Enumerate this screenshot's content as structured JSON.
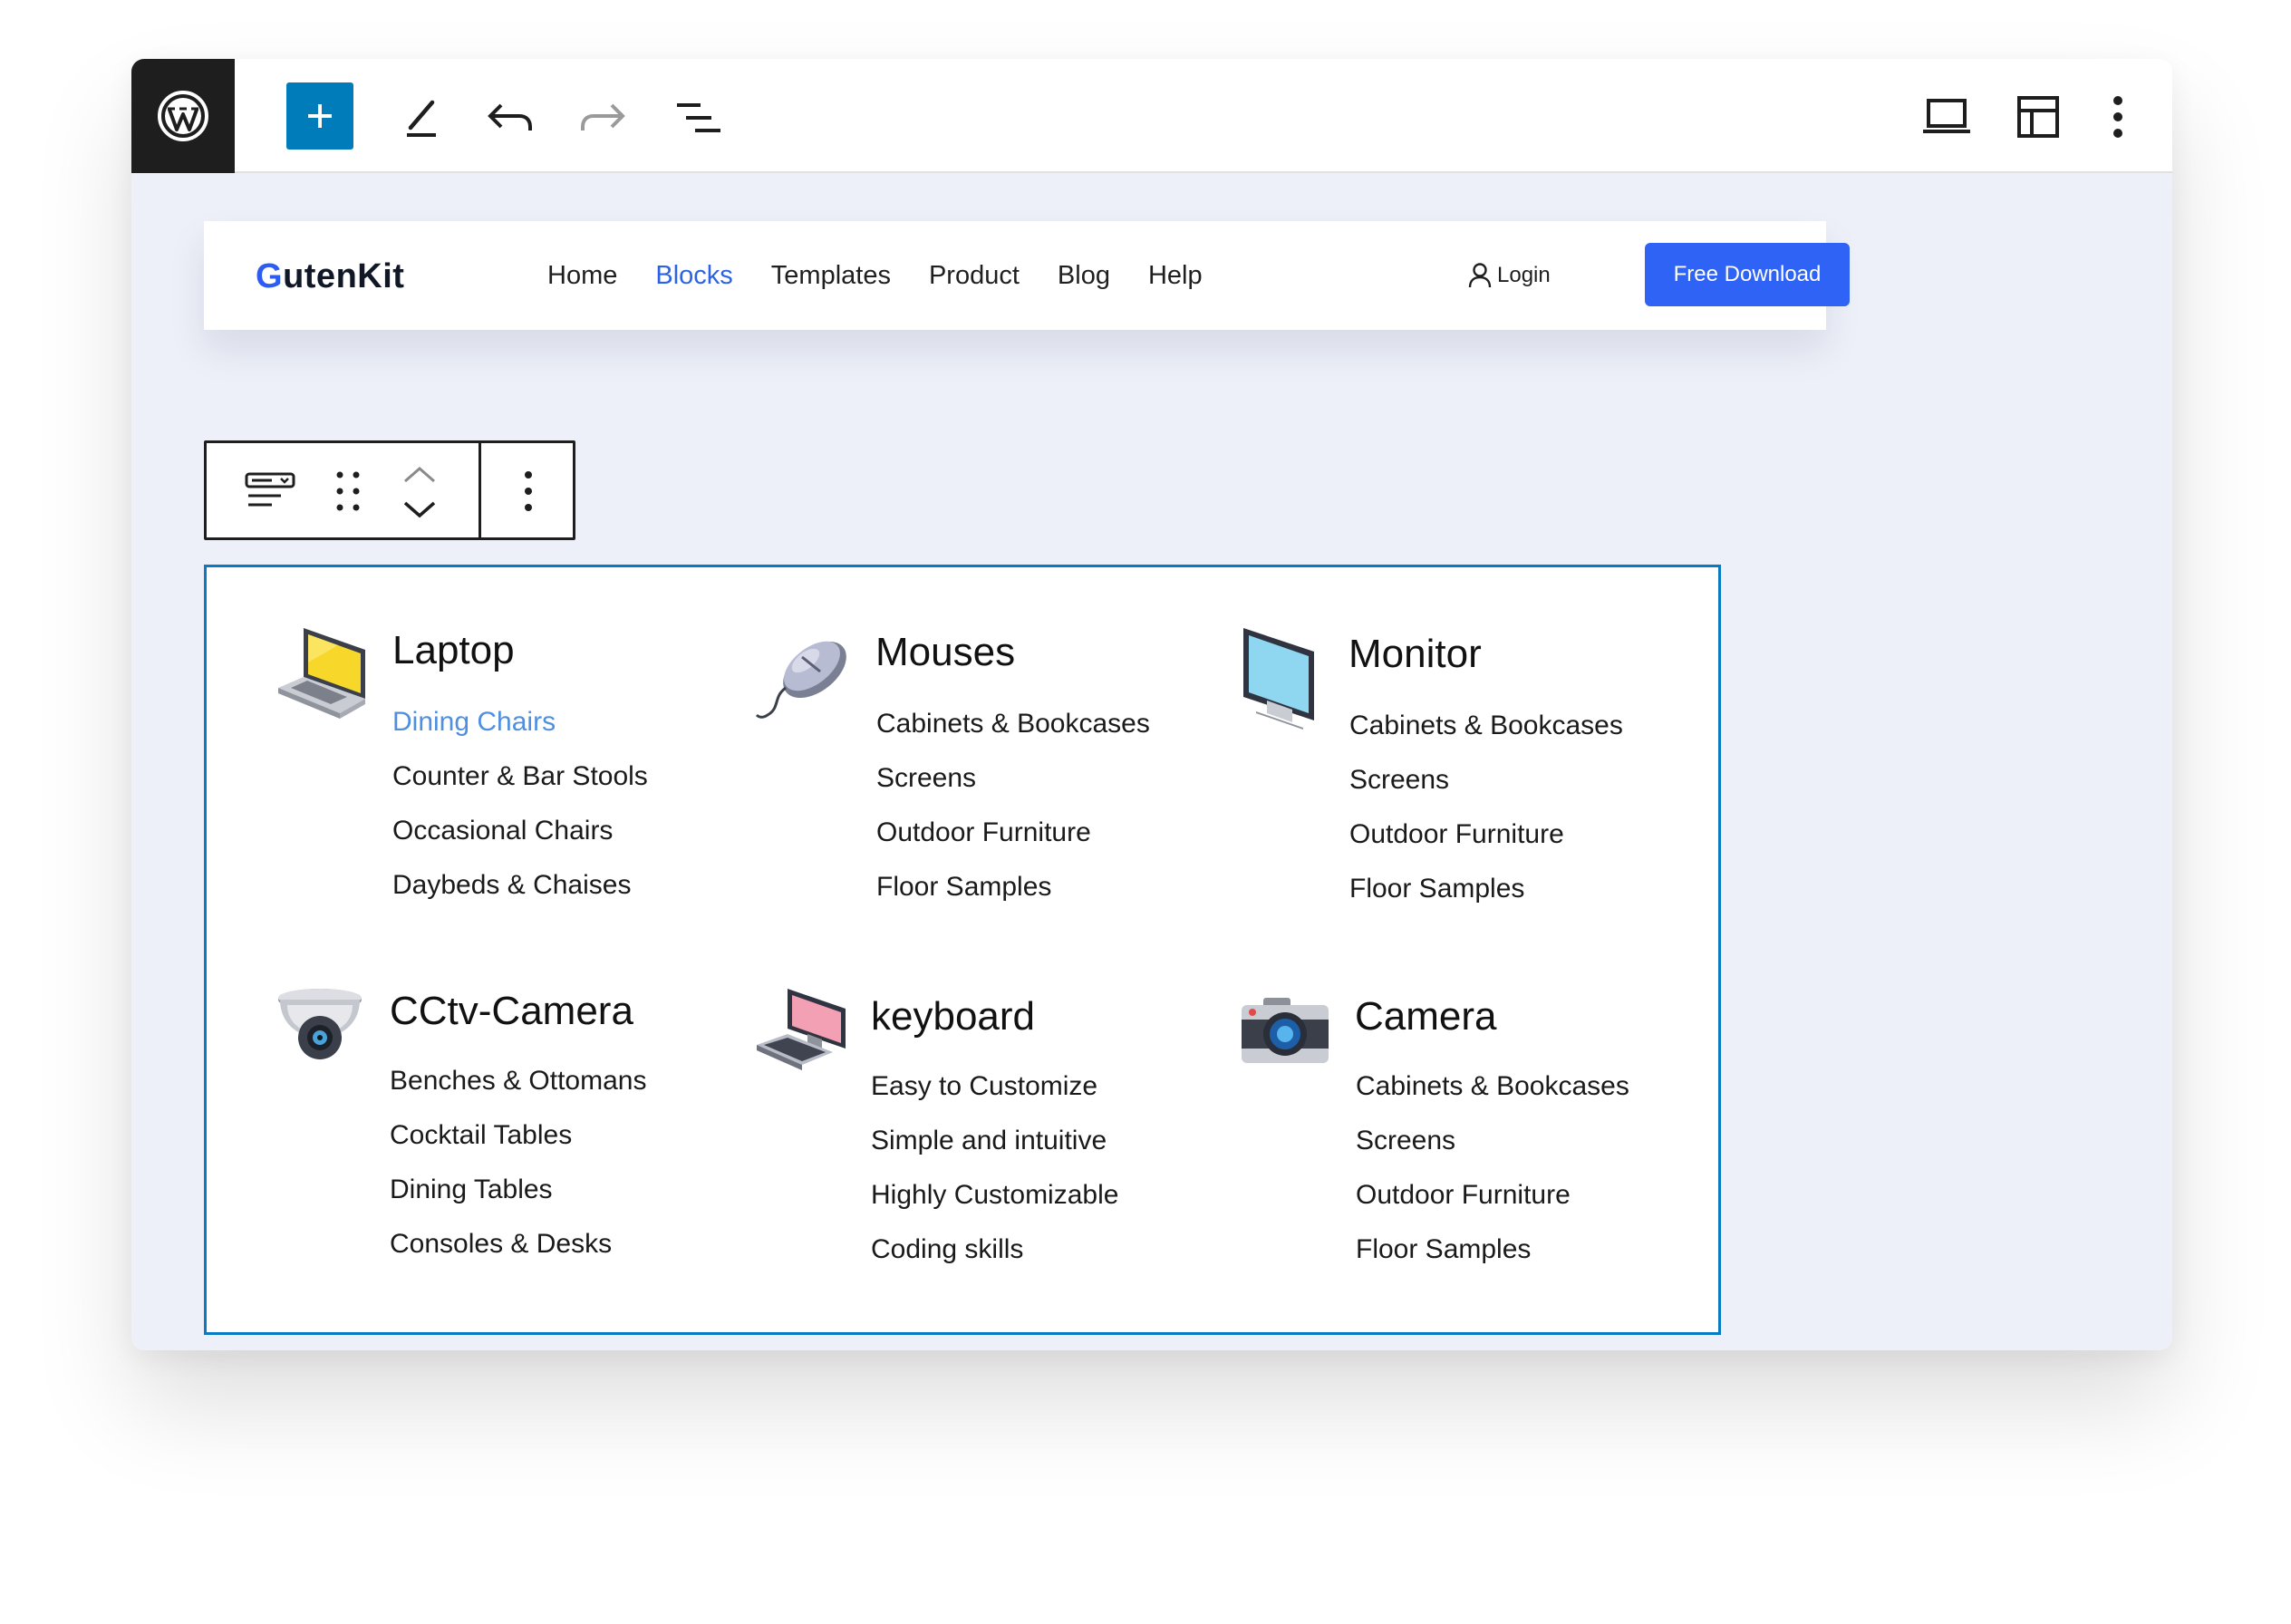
{
  "editor": {
    "toolbar_icons": [
      "wordpress-logo-icon",
      "plus-icon",
      "pencil-icon",
      "undo-icon",
      "redo-icon",
      "list-view-icon",
      "laptop-icon",
      "layout-icon",
      "more-vertical-icon"
    ]
  },
  "header": {
    "brand": {
      "first_letter": "G",
      "rest": "utenKit"
    },
    "nav": [
      {
        "label": "Home",
        "active": false
      },
      {
        "label": "Blocks",
        "active": true
      },
      {
        "label": "Templates",
        "active": false
      },
      {
        "label": "Product",
        "active": false
      },
      {
        "label": "Blog",
        "active": false
      },
      {
        "label": "Help",
        "active": false
      }
    ],
    "login_label": "Login",
    "cta_label": "Free Download"
  },
  "block_toolbar": {
    "icons": [
      "block-type-icon",
      "drag-handle-icon",
      "move-up-icon",
      "move-down-icon",
      "options-icon"
    ]
  },
  "menu": {
    "columns": [
      {
        "title": "Laptop",
        "icon": "laptop-icon",
        "items": [
          "Dining Chairs",
          "Counter & Bar Stools",
          "Occasional Chairs",
          "Daybeds & Chaises"
        ],
        "highlight_index": 0
      },
      {
        "title": "Mouses",
        "icon": "mouse-icon",
        "items": [
          "Cabinets & Bookcases",
          "Screens",
          "Outdoor Furniture",
          "Floor Samples"
        ]
      },
      {
        "title": "Monitor",
        "icon": "monitor-icon",
        "items": [
          "Cabinets & Bookcases",
          "Screens",
          "Outdoor Furniture",
          "Floor Samples"
        ]
      },
      {
        "title": "CCtv-Camera",
        "icon": "cctv-camera-icon",
        "items": [
          "Benches & Ottomans",
          "Cocktail Tables",
          "Dining Tables",
          "Consoles & Desks"
        ]
      },
      {
        "title": "keyboard",
        "icon": "keyboard-icon",
        "items": [
          "Easy to Customize",
          "Simple and intuitive",
          "Highly Customizable",
          "Coding skills"
        ]
      },
      {
        "title": "Camera",
        "icon": "camera-icon",
        "items": [
          "Cabinets & Bookcases",
          "Screens",
          "Outdoor Furniture",
          "Floor Samples"
        ]
      }
    ]
  },
  "colors": {
    "accent": "#007cba",
    "brand_blue": "#2f63f5",
    "active_nav": "#2c63e6",
    "link_highlight": "#4f8fe0",
    "canvas": "#edf0f8"
  }
}
